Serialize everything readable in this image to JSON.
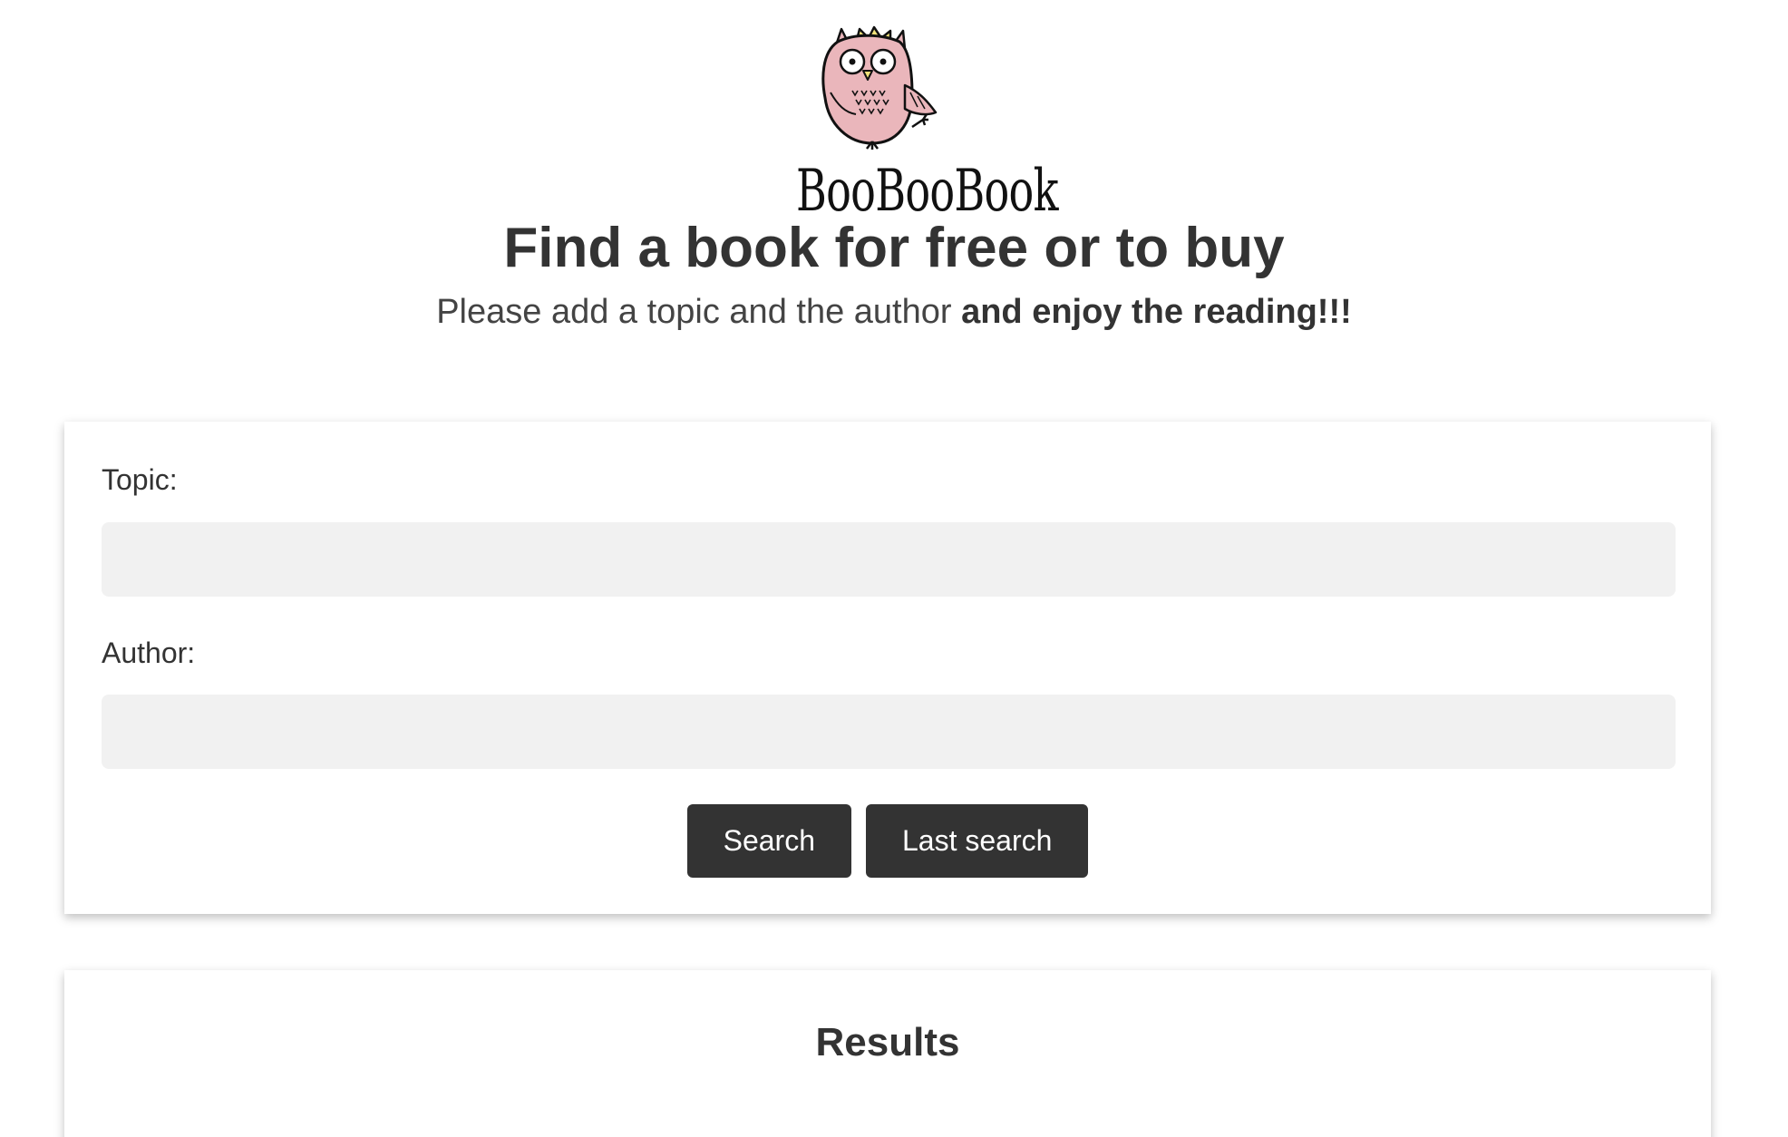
{
  "brand": {
    "name": "BooBooBook",
    "logo_icon": "owl-with-crown-icon",
    "colors": {
      "owl_body": "#eab6bb",
      "crown": "#f1e27a",
      "outline": "#111111"
    }
  },
  "header": {
    "title": "Find a book for free or to buy",
    "subtitle_plain": "Please add a topic and the author ",
    "subtitle_bold": "and enjoy the reading!!!"
  },
  "search_form": {
    "topic_label": "Topic:",
    "topic_value": "",
    "author_label": "Author:",
    "author_value": "",
    "search_button": "Search",
    "last_search_button": "Last search"
  },
  "results": {
    "title": "Results"
  },
  "colors": {
    "text": "#333333",
    "button_bg": "#333333",
    "button_text": "#ffffff",
    "input_bg": "#f1f1f1",
    "page_bg": "#ffffff"
  }
}
